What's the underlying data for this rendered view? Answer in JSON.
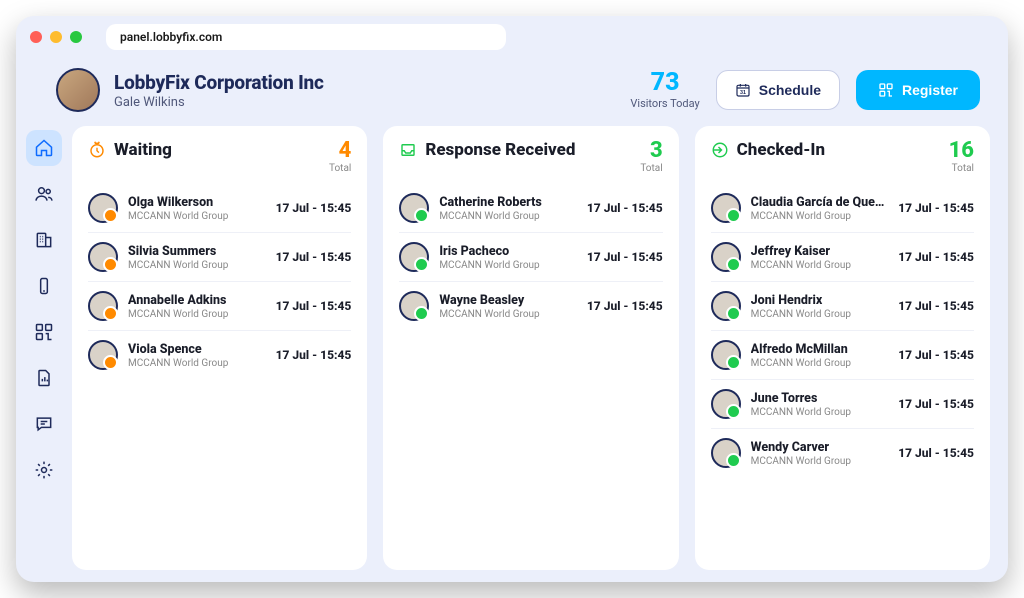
{
  "url": "panel.lobbyfix.com",
  "org": {
    "name": "LobbyFix Corporation Inc",
    "user": "Gale Wilkins"
  },
  "visitors_today": {
    "count": "73",
    "label": "Visitors Today"
  },
  "buttons": {
    "schedule": "Schedule",
    "register": "Register"
  },
  "totals_label": "Total",
  "columns": [
    {
      "key": "waiting",
      "title": "Waiting",
      "count": "4",
      "color": "orange",
      "visitors": [
        {
          "name": "Olga Wilkerson",
          "company": "MCCANN World Group",
          "time": "17 Jul - 15:45"
        },
        {
          "name": "Silvia Summers",
          "company": "MCCANN World Group",
          "time": "17 Jul - 15:45"
        },
        {
          "name": "Annabelle Adkins",
          "company": "MCCANN World Group",
          "time": "17 Jul - 15:45"
        },
        {
          "name": "Viola Spence",
          "company": "MCCANN World Group",
          "time": "17 Jul - 15:45"
        }
      ]
    },
    {
      "key": "response",
      "title": "Response Received",
      "count": "3",
      "color": "green",
      "visitors": [
        {
          "name": "Catherine Roberts",
          "company": "MCCANN World Group",
          "time": "17 Jul - 15:45"
        },
        {
          "name": "Iris Pacheco",
          "company": "MCCANN World Group",
          "time": "17 Jul - 15:45"
        },
        {
          "name": "Wayne Beasley",
          "company": "MCCANN World Group",
          "time": "17 Jul - 15:45"
        }
      ]
    },
    {
      "key": "checkedin",
      "title": "Checked-In",
      "count": "16",
      "color": "green",
      "visitors": [
        {
          "name": "Claudia García de Quevedo",
          "company": "MCCANN World Group",
          "time": "17 Jul - 15:45"
        },
        {
          "name": "Jeffrey Kaiser",
          "company": "MCCANN World Group",
          "time": "17 Jul - 15:45"
        },
        {
          "name": "Joni Hendrix",
          "company": "MCCANN World Group",
          "time": "17 Jul - 15:45"
        },
        {
          "name": "Alfredo McMillan",
          "company": "MCCANN World Group",
          "time": "17 Jul - 15:45"
        },
        {
          "name": "June Torres",
          "company": "MCCANN World Group",
          "time": "17 Jul - 15:45"
        },
        {
          "name": "Wendy Carver",
          "company": "MCCANN World Group",
          "time": "17 Jul - 15:45"
        }
      ]
    }
  ]
}
